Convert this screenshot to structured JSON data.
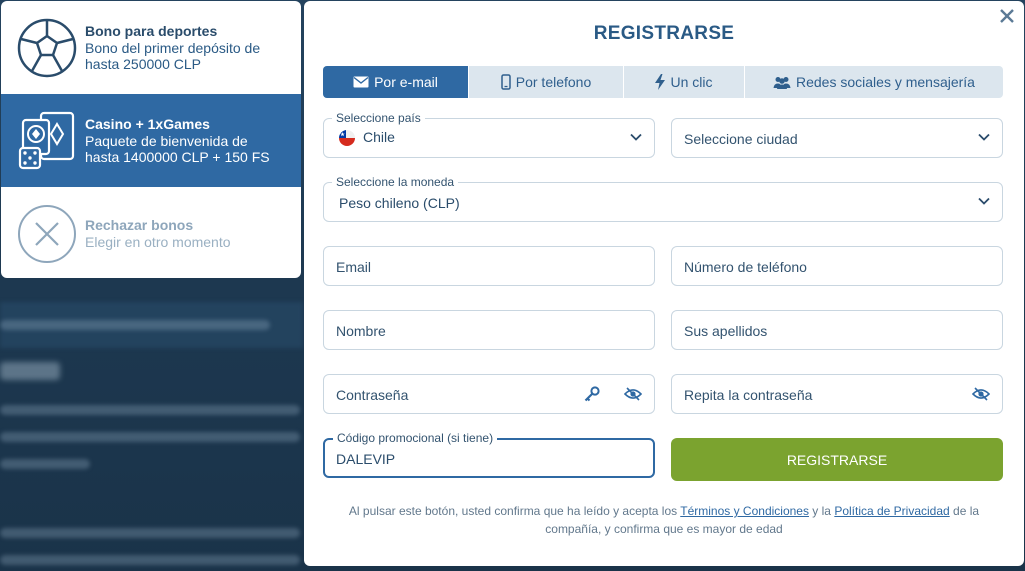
{
  "bonus_panel": {
    "items": [
      {
        "title": "Bono para deportes",
        "desc": "Bono del primer depósito de hasta 250000 CLP",
        "icon": "soccer-ball-icon"
      },
      {
        "title": "Casino + 1xGames",
        "desc": "Paquete de bienvenida de hasta 1400000 CLP + 150 FS",
        "icon": "casino-cards-dice-icon",
        "selected": true
      },
      {
        "title": "Rechazar bonos",
        "desc": "Elegir en otro momento",
        "icon": "close-circle-icon"
      }
    ]
  },
  "modal": {
    "title": "REGISTRARSE",
    "tabs": [
      {
        "label": "Por e-mail",
        "icon": "envelope-icon",
        "active": true
      },
      {
        "label": "Por telefono",
        "icon": "phone-icon"
      },
      {
        "label": "Un clic",
        "icon": "lightning-icon"
      },
      {
        "label": "Redes sociales y mensajería",
        "icon": "users-icon"
      }
    ],
    "country": {
      "label": "Seleccione país",
      "value": "Chile"
    },
    "city": {
      "placeholder": "Seleccione ciudad"
    },
    "currency": {
      "label": "Seleccione la moneda",
      "value": "Peso chileno (CLP)"
    },
    "email": {
      "placeholder": "Email"
    },
    "phone": {
      "placeholder": "Número de teléfono"
    },
    "first_name": {
      "placeholder": "Nombre"
    },
    "last_name": {
      "placeholder": "Sus apellidos"
    },
    "password": {
      "placeholder": "Contraseña"
    },
    "password_repeat": {
      "placeholder": "Repita la contraseña"
    },
    "promo": {
      "label": "Código promocional (si tiene)",
      "value": "DALEVIP"
    },
    "submit_label": "REGISTRARSE",
    "legal": {
      "part1": "Al pulsar este botón, usted confirma que ha leído y acepta los ",
      "terms_link": "Términos y Condiciones",
      "part2": " y la ",
      "privacy_link": "Política de Privacidad",
      "part3": " de la compañía, y confirma que es mayor de edad"
    }
  },
  "colors": {
    "primary": "#2f69a3",
    "submit": "#7ba32f",
    "background": "#1e3a52"
  }
}
